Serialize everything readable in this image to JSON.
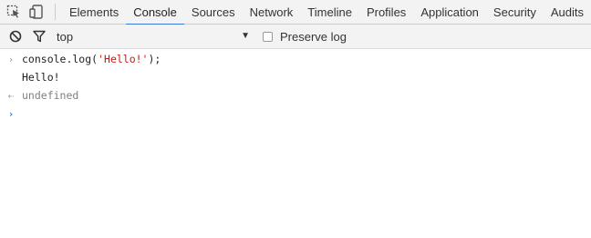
{
  "tabs": [
    {
      "label": "Elements",
      "active": false
    },
    {
      "label": "Console",
      "active": true
    },
    {
      "label": "Sources",
      "active": false
    },
    {
      "label": "Network",
      "active": false
    },
    {
      "label": "Timeline",
      "active": false
    },
    {
      "label": "Profiles",
      "active": false
    },
    {
      "label": "Application",
      "active": false
    },
    {
      "label": "Security",
      "active": false
    },
    {
      "label": "Audits",
      "active": false
    }
  ],
  "toolbar": {
    "context_value": "top",
    "preserve_log_label": "Preserve log",
    "preserve_log_checked": false
  },
  "console": {
    "input_code": "console.log(",
    "input_string": "'Hello!'",
    "input_end": ");",
    "output": "Hello!",
    "result": "undefined"
  },
  "colors": {
    "accent": "#3879d9",
    "string": "#c41a16",
    "prompt": "#367cf1"
  }
}
